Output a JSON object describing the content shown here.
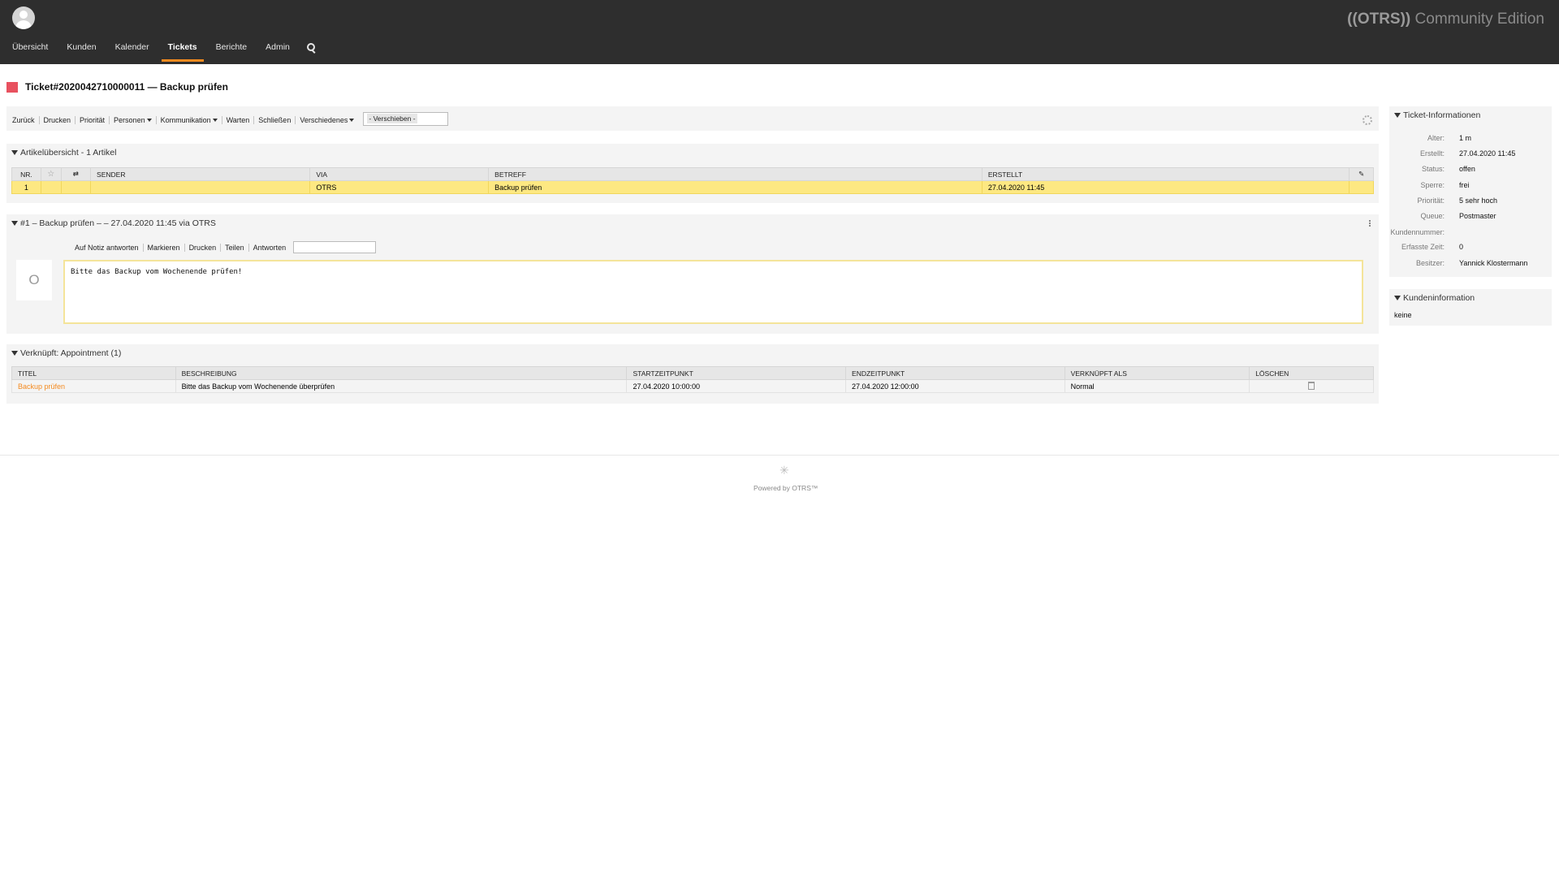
{
  "header": {
    "nav": [
      "Übersicht",
      "Kunden",
      "Kalender",
      "Tickets",
      "Berichte",
      "Admin"
    ],
    "active_nav": "Tickets",
    "logo_brand": "((OTRS))",
    "logo_edition": "Community Edition"
  },
  "ticket": {
    "title": "Ticket#2020042710000011 — Backup prüfen",
    "priority_color": "#e8515f"
  },
  "actions": {
    "back": "Zurück",
    "print": "Drucken",
    "priority": "Priorität",
    "people": "Personen",
    "communication": "Kommunikation",
    "pending": "Warten",
    "close": "Schließen",
    "misc": "Verschiedenes",
    "move": "- Verschieben -"
  },
  "article_overview": {
    "title": "Artikelübersicht - 1 Artikel",
    "columns": [
      "NR.",
      "",
      "",
      "SENDER",
      "VIA",
      "BETREFF",
      "ERSTELLT",
      ""
    ],
    "rows": [
      {
        "nr": "1",
        "sender": "",
        "via": "OTRS",
        "subject": "Backup prüfen",
        "created": "27.04.2020 11:45"
      }
    ]
  },
  "article": {
    "header": "#1 – Backup prüfen – – 27.04.2020 11:45 via OTRS",
    "actions": [
      "Auf Notiz antworten",
      "Markieren",
      "Drucken",
      "Teilen",
      "Antworten"
    ],
    "sender_initial": "O",
    "body": "Bitte das Backup vom Wochenende prüfen!"
  },
  "linked": {
    "title": "Verknüpft: Appointment (1)",
    "columns": [
      "TITEL",
      "BESCHREIBUNG",
      "STARTZEITPUNKT",
      "ENDZEITPUNKT",
      "VERKNÜPFT ALS",
      "LÖSCHEN"
    ],
    "rows": [
      {
        "title": "Backup prüfen",
        "description": "Bitte das Backup vom Wochenende überprüfen",
        "start": "27.04.2020 10:00:00",
        "end": "27.04.2020 12:00:00",
        "type": "Normal"
      }
    ]
  },
  "ticket_info": {
    "title": "Ticket-Informationen",
    "fields": [
      {
        "label": "Alter:",
        "value": "1 m"
      },
      {
        "label": "Erstellt:",
        "value": "27.04.2020 11:45"
      },
      {
        "label": "Status:",
        "value": "offen"
      },
      {
        "label": "Sperre:",
        "value": "frei"
      },
      {
        "label": "Priorität:",
        "value": "5 sehr hoch"
      },
      {
        "label": "Queue:",
        "value": "Postmaster"
      },
      {
        "label": "Kundennummer:",
        "value": ""
      },
      {
        "label": "Erfasste Zeit:",
        "value": "0"
      },
      {
        "label": "Besitzer:",
        "value": "Yannick Klostermann"
      }
    ]
  },
  "customer_info": {
    "title": "Kundeninformation",
    "value": "keine"
  },
  "footer": {
    "text": "Powered by OTRS™"
  }
}
